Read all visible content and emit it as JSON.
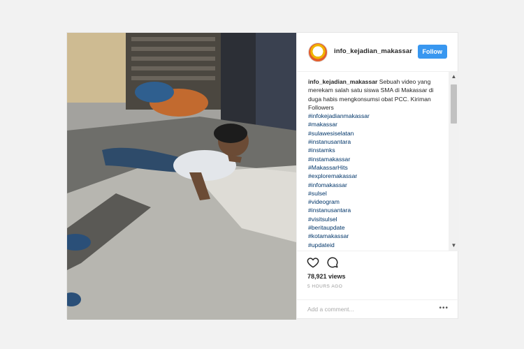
{
  "post": {
    "username": "info_kejadian_makassar",
    "follow_label": "Follow",
    "caption_user": "info_kejadian_makassar",
    "caption_text": " Sebuah video yang merekam salah satu siswa SMA di Makassar di duga habis mengkonsumsi obat PCC. Kiriman Followers",
    "hashtags": [
      "#infokejadianmakassar",
      "#makassar",
      "#sulawesiselatan",
      "#instanusantara",
      "#instamks",
      "#instamakassar",
      "#MakassarHits",
      "#exploremakassar",
      "#infomakassar",
      "#sulsel",
      "#videogram",
      "#instanusantara",
      "#visitsulsel",
      "#beritaupdate",
      "#kotamakassar",
      "#updateid"
    ],
    "views": "78,921 views",
    "timestamp": "5 HOURS AGO",
    "comment_placeholder": "Add a comment...",
    "more_label": "•••"
  },
  "icons": {
    "heart": "heart-icon",
    "comment": "comment-icon"
  },
  "colors": {
    "follow": "#3897f0",
    "hashtag": "#003569",
    "text": "#262626"
  }
}
